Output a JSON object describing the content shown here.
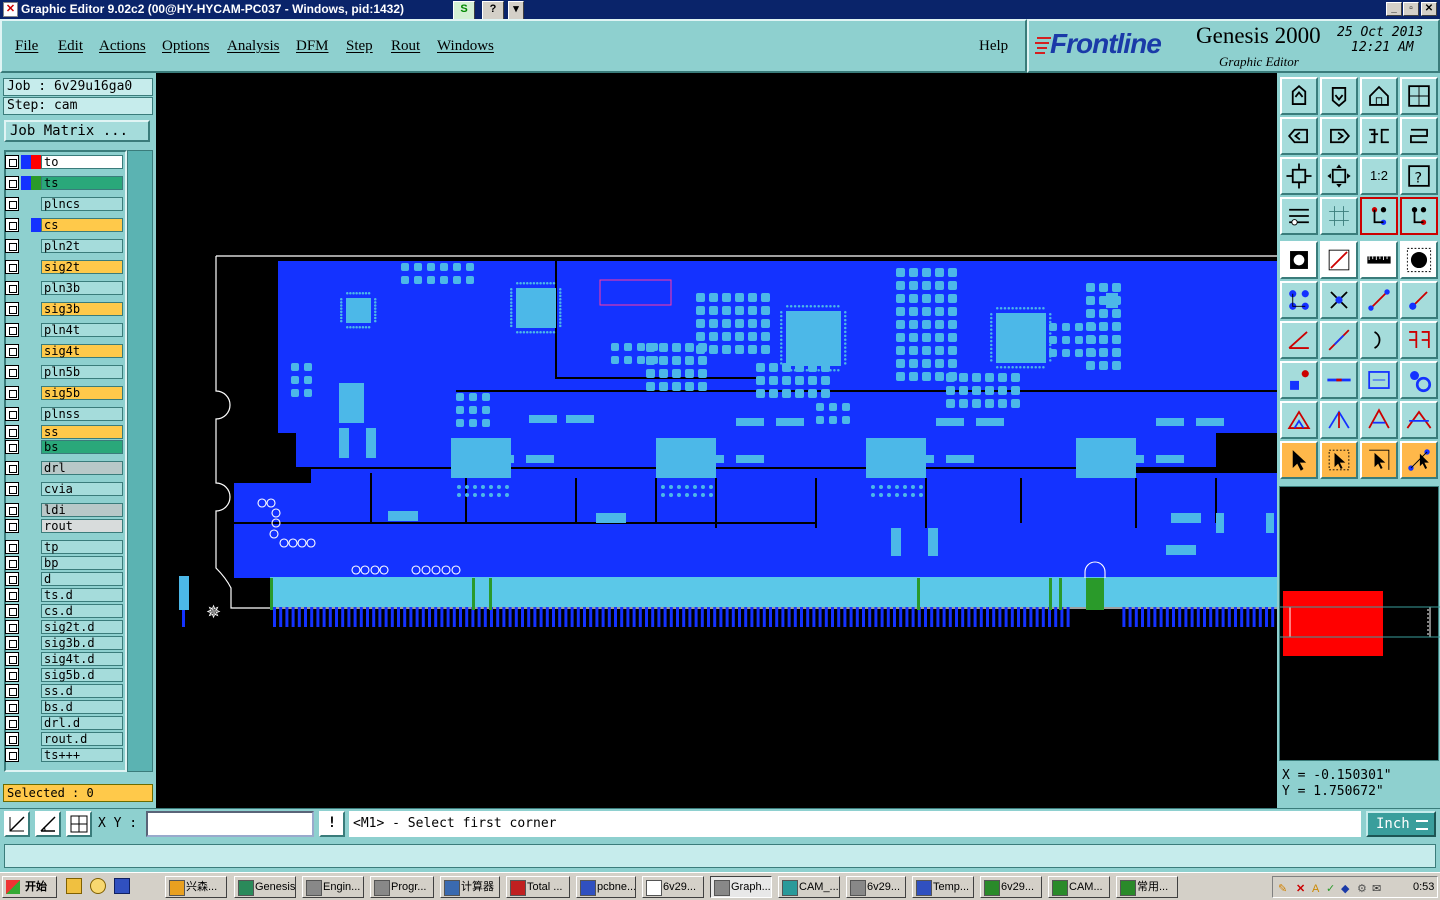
{
  "titlebar": {
    "title": "Graphic Editor 9.02c2 (00@HY-HYCAM-PC037 - Windows, pid:1432)",
    "btn_s": "S",
    "btn_help": "?",
    "btn_drop": "▾"
  },
  "menu": [
    "File",
    "Edit",
    "Actions",
    "Options",
    "Analysis",
    "DFM",
    "Step",
    "Rout",
    "Windows"
  ],
  "help": "Help",
  "brand": {
    "logo": "Frontline",
    "product": "Genesis 2000",
    "sub": "Graphic Editor",
    "date": "25 Oct 2013",
    "time": "12:21 AM"
  },
  "job": {
    "job_line": "Job : 6v29u16ga0",
    "step_line": "Step: cam",
    "matrix": "Job Matrix ..."
  },
  "layers": [
    {
      "name": "to",
      "c1": "#1432ff",
      "c2": "#ff0000",
      "bg": "#ffffff"
    },
    {
      "name": "ts",
      "c1": "#1432ff",
      "c2": "#2a9a2a",
      "bg": "#2aa87a"
    },
    {
      "name": "plncs",
      "c1": "",
      "c2": "",
      "bg": "#a5dcdb"
    },
    {
      "name": "cs",
      "c1": "",
      "c2": "#1432ff",
      "bg": "#ffc94a"
    },
    {
      "name": "pln2t",
      "c1": "",
      "c2": "",
      "bg": "#a5dcdb"
    },
    {
      "name": "sig2t",
      "c1": "",
      "c2": "",
      "bg": "#ffc94a"
    },
    {
      "name": "pln3b",
      "c1": "",
      "c2": "",
      "bg": "#a5dcdb"
    },
    {
      "name": "sig3b",
      "c1": "",
      "c2": "",
      "bg": "#ffc94a"
    },
    {
      "name": "pln4t",
      "c1": "",
      "c2": "",
      "bg": "#a5dcdb"
    },
    {
      "name": "sig4t",
      "c1": "",
      "c2": "",
      "bg": "#ffc94a"
    },
    {
      "name": "pln5b",
      "c1": "",
      "c2": "",
      "bg": "#a5dcdb"
    },
    {
      "name": "sig5b",
      "c1": "",
      "c2": "",
      "bg": "#ffc94a"
    },
    {
      "name": "plnss",
      "c1": "",
      "c2": "",
      "bg": "#a5dcdb"
    },
    {
      "name": "ss",
      "c1": "",
      "c2": "",
      "bg": "#ffc94a"
    },
    {
      "name": "bs",
      "c1": "",
      "c2": "",
      "bg": "#2aa87a"
    },
    {
      "name": "drl",
      "c1": "",
      "c2": "",
      "bg": "#b8c8c8"
    },
    {
      "name": "cvia",
      "c1": "",
      "c2": "",
      "bg": "#a5dcdb"
    },
    {
      "name": "ldi",
      "c1": "",
      "c2": "",
      "bg": "#b8c8c8"
    },
    {
      "name": "rout",
      "c1": "",
      "c2": "",
      "bg": "#d8dcdc"
    },
    {
      "name": "tp",
      "c1": "",
      "c2": "",
      "bg": "#a5dcdb"
    },
    {
      "name": "bp",
      "c1": "",
      "c2": "",
      "bg": "#a5dcdb"
    },
    {
      "name": "d",
      "c1": "",
      "c2": "",
      "bg": "#a5dcdb"
    },
    {
      "name": "ts.d",
      "c1": "",
      "c2": "",
      "bg": "#a5dcdb"
    },
    {
      "name": "cs.d",
      "c1": "",
      "c2": "",
      "bg": "#a5dcdb"
    },
    {
      "name": "sig2t.d",
      "c1": "",
      "c2": "",
      "bg": "#a5dcdb"
    },
    {
      "name": "sig3b.d",
      "c1": "",
      "c2": "",
      "bg": "#a5dcdb"
    },
    {
      "name": "sig4t.d",
      "c1": "",
      "c2": "",
      "bg": "#a5dcdb"
    },
    {
      "name": "sig5b.d",
      "c1": "",
      "c2": "",
      "bg": "#a5dcdb"
    },
    {
      "name": "ss.d",
      "c1": "",
      "c2": "",
      "bg": "#a5dcdb"
    },
    {
      "name": "bs.d",
      "c1": "",
      "c2": "",
      "bg": "#a5dcdb"
    },
    {
      "name": "drl.d",
      "c1": "",
      "c2": "",
      "bg": "#a5dcdb"
    },
    {
      "name": "rout.d",
      "c1": "",
      "c2": "",
      "bg": "#a5dcdb"
    },
    {
      "name": "ts+++",
      "c1": "",
      "c2": "",
      "bg": "#a5dcdb"
    }
  ],
  "selected": "Selected : 0",
  "coords": {
    "x": "X = -0.150301\"",
    "y": "Y = 1.750672\""
  },
  "bottom": {
    "xy_label": "X Y :",
    "prompt": "<M1> - Select first corner",
    "unit": "Inch",
    "info_btn": "!"
  },
  "taskbar": {
    "start": "开始",
    "tasks": [
      "兴森...",
      "Genesis",
      "Engin...",
      "Progr...",
      "计算器",
      "Total ...",
      "pcbne...",
      "6v29...",
      "Graph...",
      "CAM_...",
      "6v29...",
      "Temp...",
      "6v29...",
      "CAM...",
      "常用..."
    ],
    "active_task": "Graph...",
    "clock": "0:53"
  },
  "colors": {
    "panel": "#8ed0cf",
    "copper": "#1432ff",
    "pad": "#4cb8e8",
    "gold": "#5bc8e8"
  }
}
